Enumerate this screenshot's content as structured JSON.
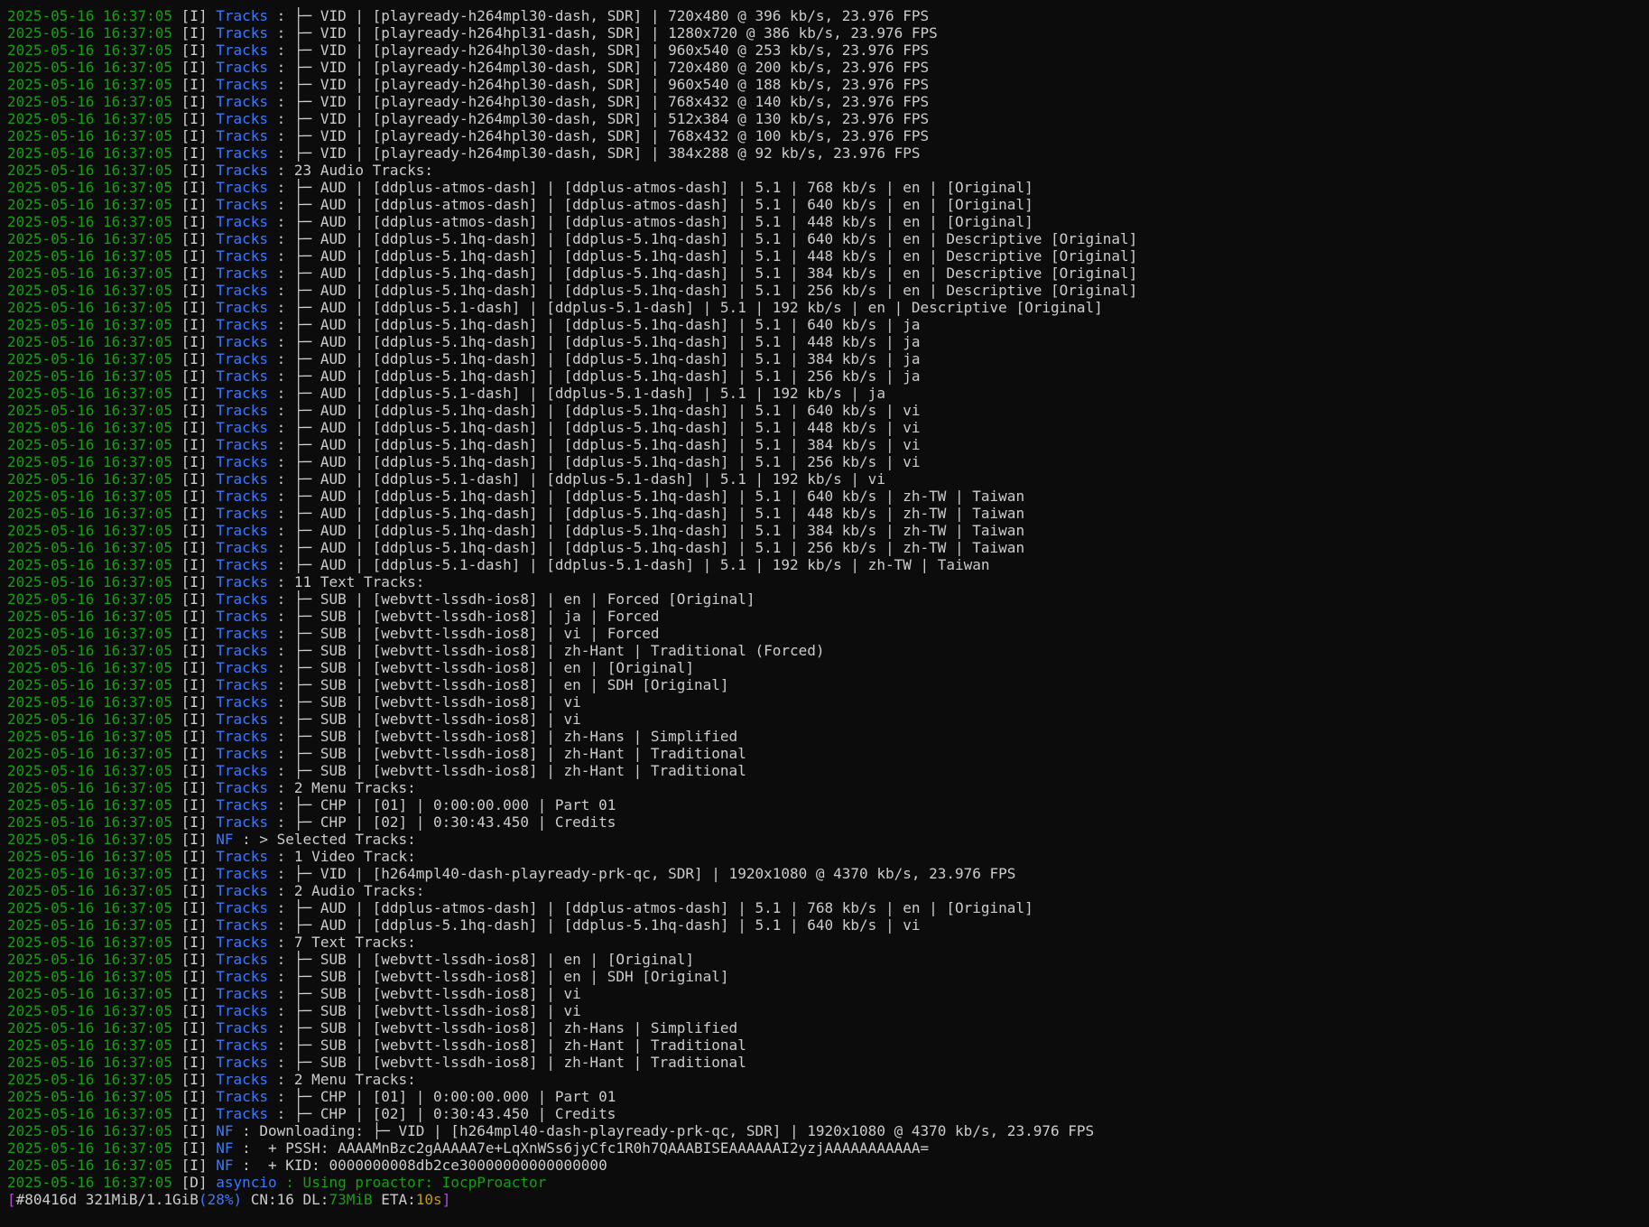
{
  "colors": {
    "background": "#0c0c0c",
    "timestamp": "#13a10e",
    "source": "#3b78ff",
    "text": "#cccccc",
    "progress_bracket": "#b14bd6",
    "eta": "#c19c00"
  },
  "log_lines": [
    {
      "ts": "2025-05-16 16:37:05",
      "level": "[I]",
      "source": "Tracks",
      "msg": " : ├─ VID | [playready-h264mpl30-dash, SDR] | 720x480 @ 396 kb/s, 23.976 FPS"
    },
    {
      "ts": "2025-05-16 16:37:05",
      "level": "[I]",
      "source": "Tracks",
      "msg": " : ├─ VID | [playready-h264hpl31-dash, SDR] | 1280x720 @ 386 kb/s, 23.976 FPS"
    },
    {
      "ts": "2025-05-16 16:37:05",
      "level": "[I]",
      "source": "Tracks",
      "msg": " : ├─ VID | [playready-h264hpl30-dash, SDR] | 960x540 @ 253 kb/s, 23.976 FPS"
    },
    {
      "ts": "2025-05-16 16:37:05",
      "level": "[I]",
      "source": "Tracks",
      "msg": " : ├─ VID | [playready-h264mpl30-dash, SDR] | 720x480 @ 200 kb/s, 23.976 FPS"
    },
    {
      "ts": "2025-05-16 16:37:05",
      "level": "[I]",
      "source": "Tracks",
      "msg": " : ├─ VID | [playready-h264hpl30-dash, SDR] | 960x540 @ 188 kb/s, 23.976 FPS"
    },
    {
      "ts": "2025-05-16 16:37:05",
      "level": "[I]",
      "source": "Tracks",
      "msg": " : ├─ VID | [playready-h264hpl30-dash, SDR] | 768x432 @ 140 kb/s, 23.976 FPS"
    },
    {
      "ts": "2025-05-16 16:37:05",
      "level": "[I]",
      "source": "Tracks",
      "msg": " : ├─ VID | [playready-h264mpl30-dash, SDR] | 512x384 @ 130 kb/s, 23.976 FPS"
    },
    {
      "ts": "2025-05-16 16:37:05",
      "level": "[I]",
      "source": "Tracks",
      "msg": " : ├─ VID | [playready-h264hpl30-dash, SDR] | 768x432 @ 100 kb/s, 23.976 FPS"
    },
    {
      "ts": "2025-05-16 16:37:05",
      "level": "[I]",
      "source": "Tracks",
      "msg": " : ├─ VID | [playready-h264mpl30-dash, SDR] | 384x288 @ 92 kb/s, 23.976 FPS"
    },
    {
      "ts": "2025-05-16 16:37:05",
      "level": "[I]",
      "source": "Tracks",
      "msg": " : 23 Audio Tracks:"
    },
    {
      "ts": "2025-05-16 16:37:05",
      "level": "[I]",
      "source": "Tracks",
      "msg": " : ├─ AUD | [ddplus-atmos-dash] | [ddplus-atmos-dash] | 5.1 | 768 kb/s | en | [Original]"
    },
    {
      "ts": "2025-05-16 16:37:05",
      "level": "[I]",
      "source": "Tracks",
      "msg": " : ├─ AUD | [ddplus-atmos-dash] | [ddplus-atmos-dash] | 5.1 | 640 kb/s | en | [Original]"
    },
    {
      "ts": "2025-05-16 16:37:05",
      "level": "[I]",
      "source": "Tracks",
      "msg": " : ├─ AUD | [ddplus-atmos-dash] | [ddplus-atmos-dash] | 5.1 | 448 kb/s | en | [Original]"
    },
    {
      "ts": "2025-05-16 16:37:05",
      "level": "[I]",
      "source": "Tracks",
      "msg": " : ├─ AUD | [ddplus-5.1hq-dash] | [ddplus-5.1hq-dash] | 5.1 | 640 kb/s | en | Descriptive [Original]"
    },
    {
      "ts": "2025-05-16 16:37:05",
      "level": "[I]",
      "source": "Tracks",
      "msg": " : ├─ AUD | [ddplus-5.1hq-dash] | [ddplus-5.1hq-dash] | 5.1 | 448 kb/s | en | Descriptive [Original]"
    },
    {
      "ts": "2025-05-16 16:37:05",
      "level": "[I]",
      "source": "Tracks",
      "msg": " : ├─ AUD | [ddplus-5.1hq-dash] | [ddplus-5.1hq-dash] | 5.1 | 384 kb/s | en | Descriptive [Original]"
    },
    {
      "ts": "2025-05-16 16:37:05",
      "level": "[I]",
      "source": "Tracks",
      "msg": " : ├─ AUD | [ddplus-5.1hq-dash] | [ddplus-5.1hq-dash] | 5.1 | 256 kb/s | en | Descriptive [Original]"
    },
    {
      "ts": "2025-05-16 16:37:05",
      "level": "[I]",
      "source": "Tracks",
      "msg": " : ├─ AUD | [ddplus-5.1-dash] | [ddplus-5.1-dash] | 5.1 | 192 kb/s | en | Descriptive [Original]"
    },
    {
      "ts": "2025-05-16 16:37:05",
      "level": "[I]",
      "source": "Tracks",
      "msg": " : ├─ AUD | [ddplus-5.1hq-dash] | [ddplus-5.1hq-dash] | 5.1 | 640 kb/s | ja"
    },
    {
      "ts": "2025-05-16 16:37:05",
      "level": "[I]",
      "source": "Tracks",
      "msg": " : ├─ AUD | [ddplus-5.1hq-dash] | [ddplus-5.1hq-dash] | 5.1 | 448 kb/s | ja"
    },
    {
      "ts": "2025-05-16 16:37:05",
      "level": "[I]",
      "source": "Tracks",
      "msg": " : ├─ AUD | [ddplus-5.1hq-dash] | [ddplus-5.1hq-dash] | 5.1 | 384 kb/s | ja"
    },
    {
      "ts": "2025-05-16 16:37:05",
      "level": "[I]",
      "source": "Tracks",
      "msg": " : ├─ AUD | [ddplus-5.1hq-dash] | [ddplus-5.1hq-dash] | 5.1 | 256 kb/s | ja"
    },
    {
      "ts": "2025-05-16 16:37:05",
      "level": "[I]",
      "source": "Tracks",
      "msg": " : ├─ AUD | [ddplus-5.1-dash] | [ddplus-5.1-dash] | 5.1 | 192 kb/s | ja"
    },
    {
      "ts": "2025-05-16 16:37:05",
      "level": "[I]",
      "source": "Tracks",
      "msg": " : ├─ AUD | [ddplus-5.1hq-dash] | [ddplus-5.1hq-dash] | 5.1 | 640 kb/s | vi"
    },
    {
      "ts": "2025-05-16 16:37:05",
      "level": "[I]",
      "source": "Tracks",
      "msg": " : ├─ AUD | [ddplus-5.1hq-dash] | [ddplus-5.1hq-dash] | 5.1 | 448 kb/s | vi"
    },
    {
      "ts": "2025-05-16 16:37:05",
      "level": "[I]",
      "source": "Tracks",
      "msg": " : ├─ AUD | [ddplus-5.1hq-dash] | [ddplus-5.1hq-dash] | 5.1 | 384 kb/s | vi"
    },
    {
      "ts": "2025-05-16 16:37:05",
      "level": "[I]",
      "source": "Tracks",
      "msg": " : ├─ AUD | [ddplus-5.1hq-dash] | [ddplus-5.1hq-dash] | 5.1 | 256 kb/s | vi"
    },
    {
      "ts": "2025-05-16 16:37:05",
      "level": "[I]",
      "source": "Tracks",
      "msg": " : ├─ AUD | [ddplus-5.1-dash] | [ddplus-5.1-dash] | 5.1 | 192 kb/s | vi"
    },
    {
      "ts": "2025-05-16 16:37:05",
      "level": "[I]",
      "source": "Tracks",
      "msg": " : ├─ AUD | [ddplus-5.1hq-dash] | [ddplus-5.1hq-dash] | 5.1 | 640 kb/s | zh-TW | Taiwan"
    },
    {
      "ts": "2025-05-16 16:37:05",
      "level": "[I]",
      "source": "Tracks",
      "msg": " : ├─ AUD | [ddplus-5.1hq-dash] | [ddplus-5.1hq-dash] | 5.1 | 448 kb/s | zh-TW | Taiwan"
    },
    {
      "ts": "2025-05-16 16:37:05",
      "level": "[I]",
      "source": "Tracks",
      "msg": " : ├─ AUD | [ddplus-5.1hq-dash] | [ddplus-5.1hq-dash] | 5.1 | 384 kb/s | zh-TW | Taiwan"
    },
    {
      "ts": "2025-05-16 16:37:05",
      "level": "[I]",
      "source": "Tracks",
      "msg": " : ├─ AUD | [ddplus-5.1hq-dash] | [ddplus-5.1hq-dash] | 5.1 | 256 kb/s | zh-TW | Taiwan"
    },
    {
      "ts": "2025-05-16 16:37:05",
      "level": "[I]",
      "source": "Tracks",
      "msg": " : ├─ AUD | [ddplus-5.1-dash] | [ddplus-5.1-dash] | 5.1 | 192 kb/s | zh-TW | Taiwan"
    },
    {
      "ts": "2025-05-16 16:37:05",
      "level": "[I]",
      "source": "Tracks",
      "msg": " : 11 Text Tracks:"
    },
    {
      "ts": "2025-05-16 16:37:05",
      "level": "[I]",
      "source": "Tracks",
      "msg": " : ├─ SUB | [webvtt-lssdh-ios8] | en | Forced [Original]"
    },
    {
      "ts": "2025-05-16 16:37:05",
      "level": "[I]",
      "source": "Tracks",
      "msg": " : ├─ SUB | [webvtt-lssdh-ios8] | ja | Forced"
    },
    {
      "ts": "2025-05-16 16:37:05",
      "level": "[I]",
      "source": "Tracks",
      "msg": " : ├─ SUB | [webvtt-lssdh-ios8] | vi | Forced"
    },
    {
      "ts": "2025-05-16 16:37:05",
      "level": "[I]",
      "source": "Tracks",
      "msg": " : ├─ SUB | [webvtt-lssdh-ios8] | zh-Hant | Traditional (Forced)"
    },
    {
      "ts": "2025-05-16 16:37:05",
      "level": "[I]",
      "source": "Tracks",
      "msg": " : ├─ SUB | [webvtt-lssdh-ios8] | en | [Original]"
    },
    {
      "ts": "2025-05-16 16:37:05",
      "level": "[I]",
      "source": "Tracks",
      "msg": " : ├─ SUB | [webvtt-lssdh-ios8] | en | SDH [Original]"
    },
    {
      "ts": "2025-05-16 16:37:05",
      "level": "[I]",
      "source": "Tracks",
      "msg": " : ├─ SUB | [webvtt-lssdh-ios8] | vi"
    },
    {
      "ts": "2025-05-16 16:37:05",
      "level": "[I]",
      "source": "Tracks",
      "msg": " : ├─ SUB | [webvtt-lssdh-ios8] | vi"
    },
    {
      "ts": "2025-05-16 16:37:05",
      "level": "[I]",
      "source": "Tracks",
      "msg": " : ├─ SUB | [webvtt-lssdh-ios8] | zh-Hans | Simplified"
    },
    {
      "ts": "2025-05-16 16:37:05",
      "level": "[I]",
      "source": "Tracks",
      "msg": " : ├─ SUB | [webvtt-lssdh-ios8] | zh-Hant | Traditional"
    },
    {
      "ts": "2025-05-16 16:37:05",
      "level": "[I]",
      "source": "Tracks",
      "msg": " : ├─ SUB | [webvtt-lssdh-ios8] | zh-Hant | Traditional"
    },
    {
      "ts": "2025-05-16 16:37:05",
      "level": "[I]",
      "source": "Tracks",
      "msg": " : 2 Menu Tracks:"
    },
    {
      "ts": "2025-05-16 16:37:05",
      "level": "[I]",
      "source": "Tracks",
      "msg": " : ├─ CHP | [01] | 0:00:00.000 | Part 01"
    },
    {
      "ts": "2025-05-16 16:37:05",
      "level": "[I]",
      "source": "Tracks",
      "msg": " : ├─ CHP | [02] | 0:30:43.450 | Credits"
    },
    {
      "ts": "2025-05-16 16:37:05",
      "level": "[I]",
      "source": "NF",
      "msg": " : > Selected Tracks:"
    },
    {
      "ts": "2025-05-16 16:37:05",
      "level": "[I]",
      "source": "Tracks",
      "msg": " : 1 Video Track:"
    },
    {
      "ts": "2025-05-16 16:37:05",
      "level": "[I]",
      "source": "Tracks",
      "msg": " : ├─ VID | [h264mpl40-dash-playready-prk-qc, SDR] | 1920x1080 @ 4370 kb/s, 23.976 FPS"
    },
    {
      "ts": "2025-05-16 16:37:05",
      "level": "[I]",
      "source": "Tracks",
      "msg": " : 2 Audio Tracks:"
    },
    {
      "ts": "2025-05-16 16:37:05",
      "level": "[I]",
      "source": "Tracks",
      "msg": " : ├─ AUD | [ddplus-atmos-dash] | [ddplus-atmos-dash] | 5.1 | 768 kb/s | en | [Original]"
    },
    {
      "ts": "2025-05-16 16:37:05",
      "level": "[I]",
      "source": "Tracks",
      "msg": " : ├─ AUD | [ddplus-5.1hq-dash] | [ddplus-5.1hq-dash] | 5.1 | 640 kb/s | vi"
    },
    {
      "ts": "2025-05-16 16:37:05",
      "level": "[I]",
      "source": "Tracks",
      "msg": " : 7 Text Tracks:"
    },
    {
      "ts": "2025-05-16 16:37:05",
      "level": "[I]",
      "source": "Tracks",
      "msg": " : ├─ SUB | [webvtt-lssdh-ios8] | en | [Original]"
    },
    {
      "ts": "2025-05-16 16:37:05",
      "level": "[I]",
      "source": "Tracks",
      "msg": " : ├─ SUB | [webvtt-lssdh-ios8] | en | SDH [Original]"
    },
    {
      "ts": "2025-05-16 16:37:05",
      "level": "[I]",
      "source": "Tracks",
      "msg": " : ├─ SUB | [webvtt-lssdh-ios8] | vi"
    },
    {
      "ts": "2025-05-16 16:37:05",
      "level": "[I]",
      "source": "Tracks",
      "msg": " : ├─ SUB | [webvtt-lssdh-ios8] | vi"
    },
    {
      "ts": "2025-05-16 16:37:05",
      "level": "[I]",
      "source": "Tracks",
      "msg": " : ├─ SUB | [webvtt-lssdh-ios8] | zh-Hans | Simplified"
    },
    {
      "ts": "2025-05-16 16:37:05",
      "level": "[I]",
      "source": "Tracks",
      "msg": " : ├─ SUB | [webvtt-lssdh-ios8] | zh-Hant | Traditional"
    },
    {
      "ts": "2025-05-16 16:37:05",
      "level": "[I]",
      "source": "Tracks",
      "msg": " : ├─ SUB | [webvtt-lssdh-ios8] | zh-Hant | Traditional"
    },
    {
      "ts": "2025-05-16 16:37:05",
      "level": "[I]",
      "source": "Tracks",
      "msg": " : 2 Menu Tracks:"
    },
    {
      "ts": "2025-05-16 16:37:05",
      "level": "[I]",
      "source": "Tracks",
      "msg": " : ├─ CHP | [01] | 0:00:00.000 | Part 01"
    },
    {
      "ts": "2025-05-16 16:37:05",
      "level": "[I]",
      "source": "Tracks",
      "msg": " : ├─ CHP | [02] | 0:30:43.450 | Credits"
    },
    {
      "ts": "2025-05-16 16:37:05",
      "level": "[I]",
      "source": "NF",
      "msg": " : Downloading: ├─ VID | [h264mpl40-dash-playready-prk-qc, SDR] | 1920x1080 @ 4370 kb/s, 23.976 FPS"
    },
    {
      "ts": "2025-05-16 16:37:05",
      "level": "[I]",
      "source": "NF",
      "msg": " :  + PSSH: AAAAMnBzc2gAAAAA7e+LqXnWSs6jyCfc1R0h7QAAABISEAAAAAAI2yzjAAAAAAAAAAA="
    },
    {
      "ts": "2025-05-16 16:37:05",
      "level": "[I]",
      "source": "NF",
      "msg": " :  + KID: 0000000008db2ce30000000000000000"
    },
    {
      "ts": "2025-05-16 16:37:05",
      "level": "[D]",
      "source": "asyncio",
      "msg": " : Using proactor: IocpProactor"
    }
  ],
  "progress": {
    "open": "[",
    "task_id": "#80416d",
    "size": " 321MiB/1.1GiB",
    "percent": "(28%)",
    "cn": " CN:16 DL:",
    "dl_rate": "73MiB",
    "eta_label": " ETA:",
    "eta": "10s",
    "close": "]"
  }
}
